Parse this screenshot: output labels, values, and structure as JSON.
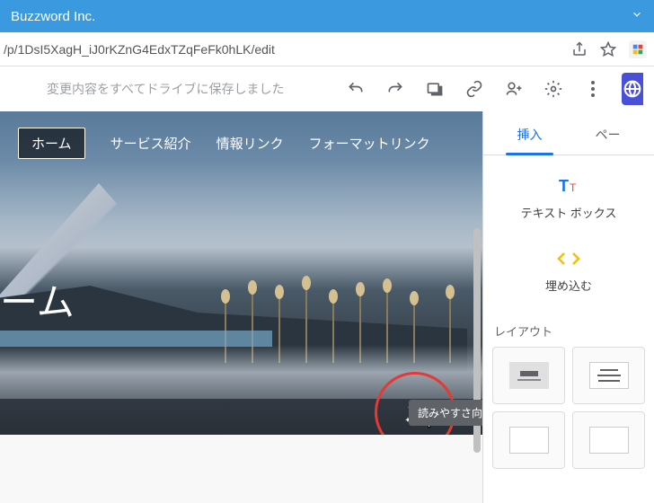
{
  "titlebar": {
    "text": "Buzzword Inc."
  },
  "url": {
    "path": "/p/1DsI5XagH_iJ0rKZnG4EdxTZqFeFk0hLK/edit"
  },
  "toolbar": {
    "save_status": "変更内容をすべてドライブに保存しました"
  },
  "hero": {
    "nav": {
      "items": [
        {
          "label": "ホーム",
          "active": true
        },
        {
          "label": "サービス紹介",
          "active": false
        },
        {
          "label": "情報リンク",
          "active": false
        },
        {
          "label": "フォーマットリンク",
          "active": false
        }
      ]
    },
    "title_fragment": "ーム"
  },
  "tooltip": {
    "text": "読みやすさ向上のための調整を解除"
  },
  "sidepanel": {
    "tabs": [
      {
        "label": "挿入",
        "active": true
      },
      {
        "label": "ペー",
        "active": false
      }
    ],
    "items": [
      {
        "label": "テキスト ボックス",
        "icon": "textbox"
      },
      {
        "label": "埋め込む",
        "icon": "embed"
      }
    ],
    "section_title": "レイアウト"
  }
}
